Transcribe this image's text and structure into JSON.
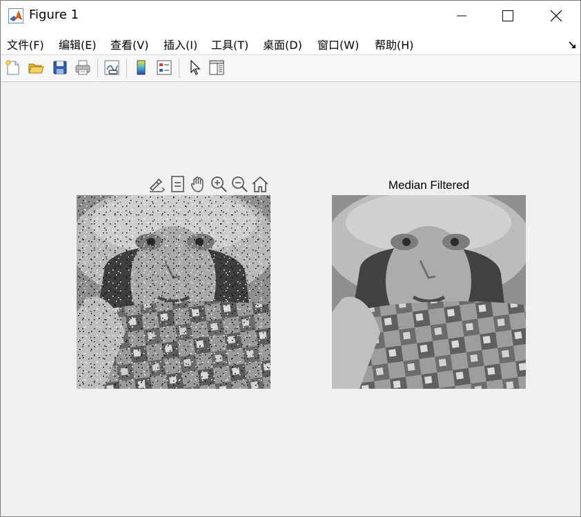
{
  "window": {
    "title": "Figure 1",
    "icon": "matlab-logo-icon"
  },
  "menu": {
    "items": [
      {
        "label": "文件(F)"
      },
      {
        "label": "编辑(E)"
      },
      {
        "label": "查看(V)"
      },
      {
        "label": "插入(I)"
      },
      {
        "label": "工具(T)"
      },
      {
        "label": "桌面(D)"
      },
      {
        "label": "窗口(W)"
      },
      {
        "label": "帮助(H)"
      }
    ]
  },
  "toolbar": {
    "buttons": [
      "new-figure-icon",
      "open-file-icon",
      "save-icon",
      "print-icon",
      "link-plot-icon",
      "colorbar-icon",
      "legend-icon",
      "edit-plot-arrow-icon",
      "property-inspector-icon"
    ]
  },
  "axes_toolbar": {
    "buttons": [
      "brush-export-icon",
      "datatip-icon",
      "pan-hand-icon",
      "zoom-in-icon",
      "zoom-out-icon",
      "restore-view-home-icon"
    ]
  },
  "axes": [
    {
      "title": ""
    },
    {
      "title": "Median Filtered"
    }
  ]
}
